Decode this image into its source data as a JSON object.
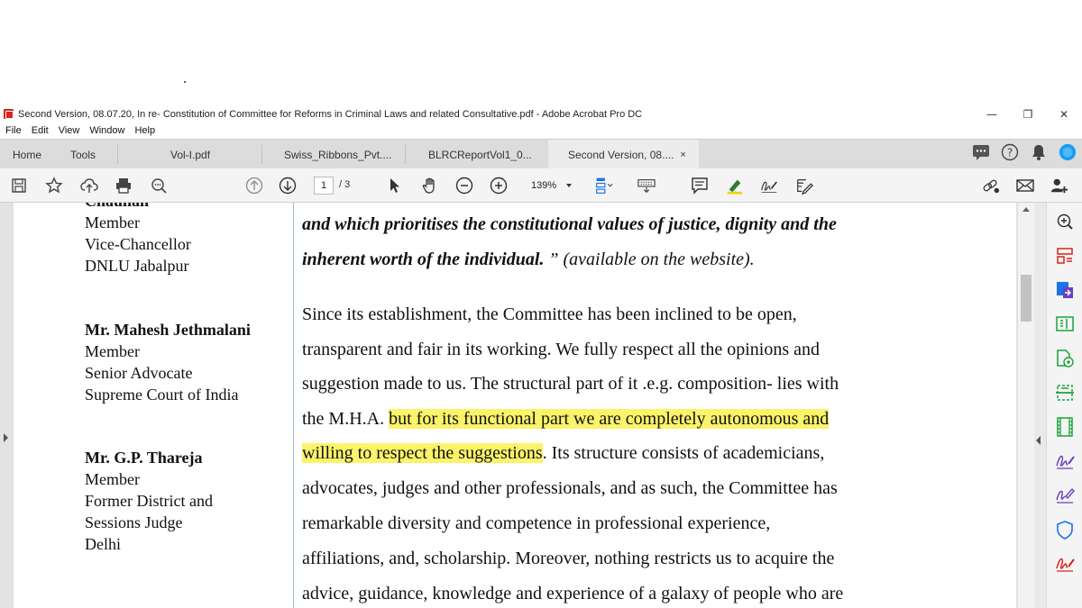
{
  "window": {
    "title": "Second Version, 08.07.20, In re- Constitution of Committee for Reforms in Criminal Laws and related Consultative.pdf - Adobe Acrobat Pro DC",
    "minimize": "—",
    "restore": "❐",
    "close": "✕"
  },
  "menu": [
    "File",
    "Edit",
    "View",
    "Window",
    "Help"
  ],
  "tabs": {
    "home": "Home",
    "tools": "Tools",
    "docs": [
      {
        "label": "Vol-I.pdf"
      },
      {
        "label": "Swiss_Ribbons_Pvt...."
      },
      {
        "label": "BLRCReportVol1_0..."
      },
      {
        "label": "Second Version, 08....",
        "close": "×"
      }
    ]
  },
  "toolbar": {
    "page_current": "1",
    "page_total": "/ 3",
    "zoom": "139%"
  },
  "icons": {
    "save": "save-icon",
    "star": "star-icon",
    "upload": "upload-icon",
    "print": "print-icon",
    "search": "search-icon",
    "prev": "arrow-up-icon",
    "next": "arrow-down-icon",
    "select": "cursor-icon",
    "hand": "hand-icon",
    "zoom_out": "zoom-out-icon",
    "zoom_in": "zoom-in-icon",
    "fit": "fit-page-icon",
    "keyboard": "keyboard-icon",
    "comment": "comment-icon",
    "highlight": "highlight-icon",
    "sign": "sign-icon",
    "edit": "edit-icon",
    "share_link": "link-icon",
    "mail": "mail-icon",
    "add_user": "add-user-icon",
    "chat": "chat-icon",
    "help": "help-icon",
    "bell": "bell-icon",
    "avatar": "avatar-icon"
  },
  "colors": {
    "highlight": "#fbf36a",
    "accent": "#1a73e8",
    "acrobat_red": "#d9231d",
    "tool_green": "#1aa33a",
    "tool_purple": "#6b3fbf"
  },
  "document": {
    "left_column": {
      "cut_line": "Chauhan",
      "block1": [
        "Member",
        "Vice-Chancellor",
        "DNLU Jabalpur"
      ],
      "block2_name": "Mr. Mahesh Jethmalani",
      "block2": [
        "Member",
        "Senior Advocate",
        "Supreme Court of India"
      ],
      "block3_name": "Mr. G.P. Thareja",
      "block3": [
        "Member",
        "Former District and",
        "Sessions Judge",
        "Delhi"
      ]
    },
    "right_column": {
      "line1": "and which prioritises the constitutional values of justice, dignity and the",
      "line2_bi": "inherent worth of the individual.",
      "line2_rest": " ” (available on the website).",
      "line3": "Since its establishment, the Committee has been inclined to be open,",
      "line4": "transparent and fair in its working. We fully respect all the opinions and",
      "line5": "suggestion made to us. The structural part of it .e.g. composition-  lies with",
      "line6_pre": "the M.H.A. ",
      "line6_hl": "but for its functional part we are completely autonomous and",
      "line7_hl": "willing  to respect the suggestions",
      "line7_rest": ". Its structure consists of academicians,",
      "line8": "advocates, judges and other professionals, and as such, the Committee has",
      "line9": "remarkable  diversity  and  competence  in  professional  experience,",
      "line10": "affiliations, and, scholarship. Moreover, nothing restricts us to acquire the",
      "line11": "advice, guidance, knowledge and experience of a galaxy of people who are"
    }
  }
}
